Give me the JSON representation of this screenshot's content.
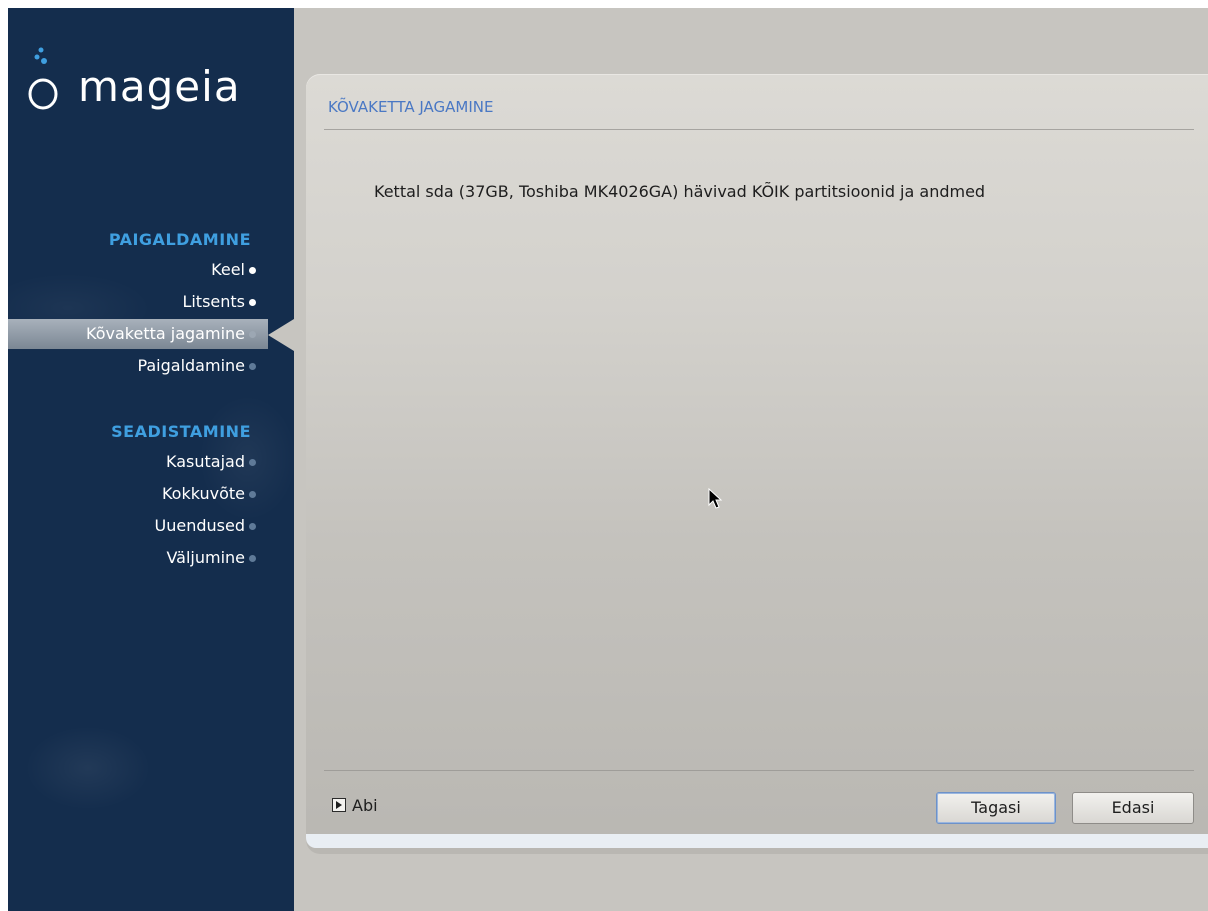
{
  "app": {
    "logo_text": "mageia"
  },
  "sidebar": {
    "sections": [
      {
        "title": "PAIGALDAMINE",
        "items": [
          {
            "label": "Keel",
            "state": "done"
          },
          {
            "label": "Litsents",
            "state": "done"
          },
          {
            "label": "Kõvaketta jagamine",
            "state": "active"
          },
          {
            "label": "Paigaldamine",
            "state": "pending"
          }
        ]
      },
      {
        "title": "SEADISTAMINE",
        "items": [
          {
            "label": "Kasutajad",
            "state": "pending"
          },
          {
            "label": "Kokkuvõte",
            "state": "pending"
          },
          {
            "label": "Uuendused",
            "state": "pending"
          },
          {
            "label": "Väljumine",
            "state": "pending"
          }
        ]
      }
    ]
  },
  "main": {
    "title": "KÕVAKETTA JAGAMINE",
    "message": "Kettal sda (37GB, Toshiba MK4026GA) hävivad KÕIK partitsioonid ja andmed",
    "help_label": "Abi",
    "back_label": "Tagasi",
    "next_label": "Edasi"
  },
  "colors": {
    "sidebar_bg": "#142d4d",
    "section_title": "#3f9fe0",
    "panel_title": "#4a78c4"
  }
}
